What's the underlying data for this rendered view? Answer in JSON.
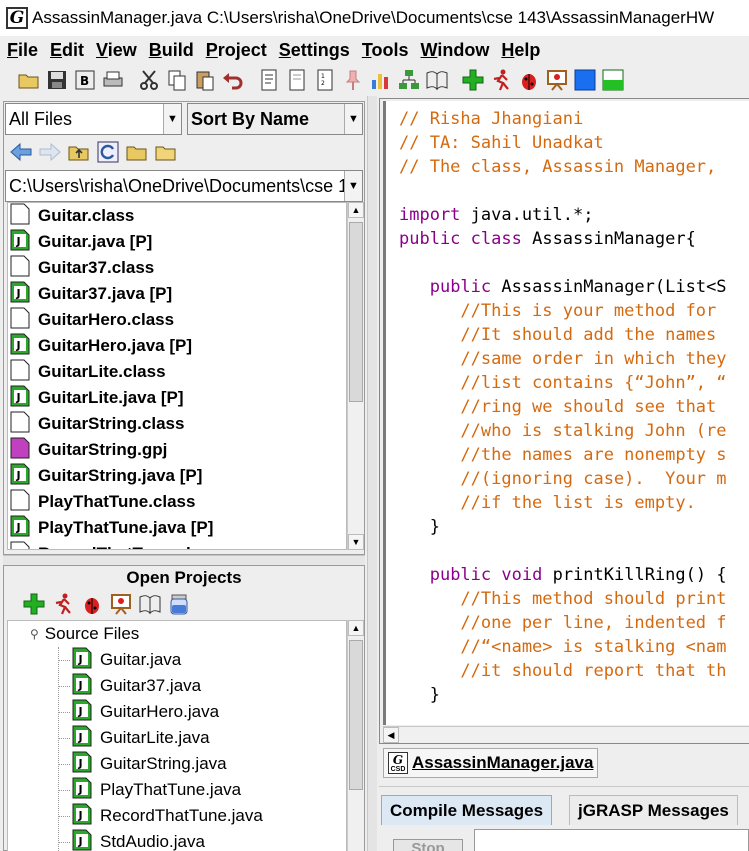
{
  "window": {
    "title": "AssassinManager.java  C:\\Users\\risha\\OneDrive\\Documents\\cse 143\\AssassinManagerHW",
    "app_icon_letter": "G"
  },
  "menu": [
    {
      "label": "File",
      "mnemonic": "F",
      "rest": "ile"
    },
    {
      "label": "Edit",
      "mnemonic": "E",
      "rest": "dit"
    },
    {
      "label": "View",
      "mnemonic": "V",
      "rest": "iew"
    },
    {
      "label": "Build",
      "mnemonic": "B",
      "rest": "uild"
    },
    {
      "label": "Project",
      "mnemonic": "P",
      "rest": "roject"
    },
    {
      "label": "Settings",
      "mnemonic": "S",
      "rest": "ettings"
    },
    {
      "label": "Tools",
      "mnemonic": "T",
      "rest": "ools"
    },
    {
      "label": "Window",
      "mnemonic": "W",
      "rest": "indow"
    },
    {
      "label": "Help",
      "mnemonic": "H",
      "rest": "elp"
    }
  ],
  "browse": {
    "filter": "All Files",
    "sort": "Sort By Name",
    "path": "C:\\Users\\risha\\OneDrive\\Documents\\cse 1",
    "files": [
      {
        "name": "Guitar.class",
        "kind": "class"
      },
      {
        "name": "Guitar.java [P]",
        "kind": "java"
      },
      {
        "name": "Guitar37.class",
        "kind": "class"
      },
      {
        "name": "Guitar37.java [P]",
        "kind": "java"
      },
      {
        "name": "GuitarHero.class",
        "kind": "class"
      },
      {
        "name": "GuitarHero.java [P]",
        "kind": "java"
      },
      {
        "name": "GuitarLite.class",
        "kind": "class"
      },
      {
        "name": "GuitarLite.java [P]",
        "kind": "java"
      },
      {
        "name": "GuitarString.class",
        "kind": "class"
      },
      {
        "name": "GuitarString.gpj",
        "kind": "gpj"
      },
      {
        "name": "GuitarString.java [P]",
        "kind": "java"
      },
      {
        "name": "PlayThatTune.class",
        "kind": "class"
      },
      {
        "name": "PlayThatTune.java [P]",
        "kind": "java"
      },
      {
        "name": "RecordThatTune.class",
        "kind": "class"
      }
    ]
  },
  "projects": {
    "title": "Open Projects",
    "root": "Source Files",
    "files": [
      "Guitar.java",
      "Guitar37.java",
      "GuitarHero.java",
      "GuitarLite.java",
      "GuitarString.java",
      "PlayThatTune.java",
      "RecordThatTune.java",
      "StdAudio.java"
    ]
  },
  "editor": {
    "lines": [
      [
        {
          "t": "// Risha Jhangiani",
          "c": "cm"
        }
      ],
      [
        {
          "t": "// TA: Sahil Unadkat",
          "c": "cm"
        }
      ],
      [
        {
          "t": "// The class, Assassin Manager,",
          "c": "cm"
        }
      ],
      [],
      [
        {
          "t": "import",
          "c": "kw"
        },
        {
          "t": " java.util.*;",
          "c": "tx"
        }
      ],
      [
        {
          "t": "public",
          "c": "kw"
        },
        {
          "t": " ",
          "c": "tx"
        },
        {
          "t": "class",
          "c": "kw"
        },
        {
          "t": " AssassinManager{",
          "c": "tx"
        }
      ],
      [],
      [
        {
          "t": "   ",
          "c": "tx"
        },
        {
          "t": "public",
          "c": "kw"
        },
        {
          "t": " AssassinManager(List<S",
          "c": "tx"
        }
      ],
      [
        {
          "t": "      //This is your method for",
          "c": "cm"
        }
      ],
      [
        {
          "t": "      //It should add the names",
          "c": "cm"
        }
      ],
      [
        {
          "t": "      //same order in which they",
          "c": "cm"
        }
      ],
      [
        {
          "t": "      //list contains {“John”, “",
          "c": "cm"
        }
      ],
      [
        {
          "t": "      //ring we should see that",
          "c": "cm"
        }
      ],
      [
        {
          "t": "      //who is stalking John (re",
          "c": "cm"
        }
      ],
      [
        {
          "t": "      //the names are nonempty s",
          "c": "cm"
        }
      ],
      [
        {
          "t": "      //(ignoring case).  Your m",
          "c": "cm"
        }
      ],
      [
        {
          "t": "      //if the list is empty.",
          "c": "cm"
        }
      ],
      [
        {
          "t": "   }",
          "c": "tx"
        }
      ],
      [],
      [
        {
          "t": "   ",
          "c": "tx"
        },
        {
          "t": "public",
          "c": "kw"
        },
        {
          "t": " ",
          "c": "tx"
        },
        {
          "t": "void",
          "c": "kw"
        },
        {
          "t": " printKillRing() {",
          "c": "tx"
        }
      ],
      [
        {
          "t": "      //This method should print",
          "c": "cm"
        }
      ],
      [
        {
          "t": "      //one per line, indented f",
          "c": "cm"
        }
      ],
      [
        {
          "t": "      //“<name> is stalking <nam",
          "c": "cm"
        }
      ],
      [
        {
          "t": "      //it should report that th",
          "c": "cm"
        }
      ],
      [
        {
          "t": "   }",
          "c": "tx"
        }
      ]
    ]
  },
  "editor_tab": {
    "label": "AssassinManager.java",
    "icon_text": "CSD"
  },
  "messages": {
    "tabs": [
      "Compile Messages",
      "jGRASP Messages"
    ],
    "stop_label": "Stop"
  },
  "colors": {
    "comment": "#d46a10",
    "keyword": "#8b008b",
    "java_icon": "#2aa82a",
    "gpj_icon": "#c040c0"
  }
}
